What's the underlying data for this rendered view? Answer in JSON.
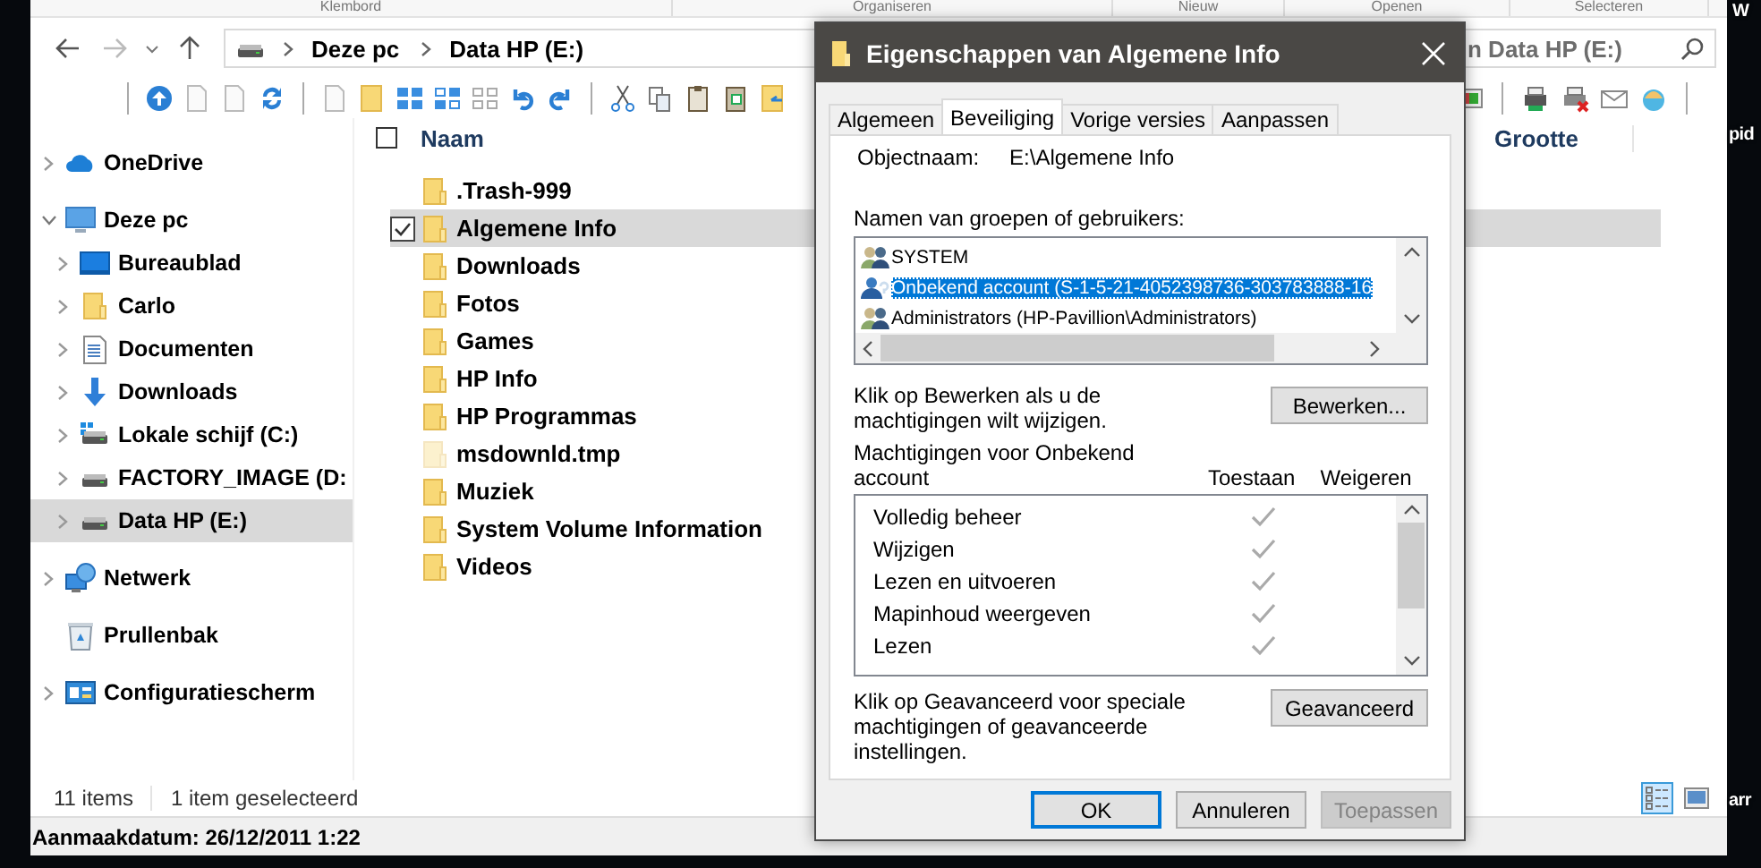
{
  "ribbon_groups": [
    "Klembord",
    "Organiseren",
    "Nieuw",
    "Openen",
    "Selecteren"
  ],
  "address": {
    "segments": [
      "Deze pc",
      "Data HP (E:)"
    ]
  },
  "search": {
    "placeholder": "n Data HP (E:)"
  },
  "columns": [
    "Naam",
    "Grootte"
  ],
  "select_all": {
    "checked": false
  },
  "sidebar": {
    "items": [
      {
        "label": "OneDrive",
        "kind": "cloud",
        "expandable": true,
        "expanded": false,
        "selected": false
      },
      {
        "label": "Deze pc",
        "kind": "computer",
        "expandable": true,
        "expanded": true,
        "selected": false,
        "children": [
          {
            "label": "Bureaublad",
            "kind": "desktop",
            "expandable": true,
            "expanded": false,
            "selected": false
          },
          {
            "label": "Carlo",
            "kind": "folder",
            "expandable": true,
            "expanded": false,
            "selected": false
          },
          {
            "label": "Documenten",
            "kind": "document",
            "expandable": true,
            "expanded": false,
            "selected": false
          },
          {
            "label": "Downloads",
            "kind": "download",
            "expandable": true,
            "expanded": false,
            "selected": false
          },
          {
            "label": "Lokale schijf (C:)",
            "kind": "system-drive",
            "expandable": true,
            "expanded": false,
            "selected": false
          },
          {
            "label": "FACTORY_IMAGE (D:",
            "kind": "drive",
            "expandable": true,
            "expanded": false,
            "selected": false
          },
          {
            "label": "Data HP (E:)",
            "kind": "drive",
            "expandable": true,
            "expanded": false,
            "selected": true
          }
        ]
      },
      {
        "label": "Netwerk",
        "kind": "network",
        "expandable": true,
        "expanded": false,
        "selected": false
      },
      {
        "label": "Prullenbak",
        "kind": "recycle-bin",
        "expandable": false,
        "selected": false
      },
      {
        "label": "Configuratiescherm",
        "kind": "control-panel",
        "expandable": true,
        "expanded": false,
        "selected": false
      }
    ]
  },
  "files": [
    {
      "name": ".Trash-999",
      "kind": "folder",
      "selected": false
    },
    {
      "name": "Algemene Info",
      "kind": "folder",
      "selected": true
    },
    {
      "name": "Downloads",
      "kind": "folder",
      "selected": false
    },
    {
      "name": "Fotos",
      "kind": "folder",
      "selected": false
    },
    {
      "name": "Games",
      "kind": "folder",
      "selected": false
    },
    {
      "name": "HP Info",
      "kind": "folder",
      "selected": false
    },
    {
      "name": "HP Programmas",
      "kind": "folder",
      "selected": false
    },
    {
      "name": "msdownld.tmp",
      "kind": "hidden-folder",
      "selected": false
    },
    {
      "name": "Muziek",
      "kind": "folder",
      "selected": false
    },
    {
      "name": "System Volume Information",
      "kind": "folder",
      "selected": false
    },
    {
      "name": "Videos",
      "kind": "folder",
      "selected": false
    }
  ],
  "status_bar": {
    "count": "11 items",
    "selection": "1 item geselecteerd",
    "views": [
      {
        "selected": true
      },
      {
        "selected": false
      }
    ]
  },
  "details_bar": {
    "text": "Aanmaakdatum: 26/12/2011 1:22"
  },
  "desktop_labels": [
    "W",
    "pid",
    "arr"
  ],
  "dialog": {
    "title": "Eigenschappen van Algemene Info",
    "tabs": [
      {
        "label": "Algemeen",
        "selected": false
      },
      {
        "label": "Beveiliging",
        "selected": true
      },
      {
        "label": "Vorige versies",
        "selected": false
      },
      {
        "label": "Aanpassen",
        "selected": false
      }
    ],
    "object_label": "Objectnaam:",
    "object_value": "E:\\Algemene Info",
    "principals_label": "Namen van groepen of gebruikers:",
    "principals": [
      {
        "name": "SYSTEM",
        "kind": "group",
        "selected": false
      },
      {
        "name": "Onbekend account (S-1-5-21-4052398736-303783888-16",
        "kind": "unknown",
        "selected": true
      },
      {
        "name": "Administrators (HP-Pavillion\\Administrators)",
        "kind": "group",
        "selected": false
      }
    ],
    "edit_hint": "Klik op Bewerken als u de machtigingen wilt wijzigen.",
    "edit_button": "Bewerken...",
    "permissions_label": "Machtigingen voor Onbekend account",
    "allow_header": "Toestaan",
    "deny_header": "Weigeren",
    "permissions": [
      {
        "name": "Volledig beheer",
        "allow": true,
        "deny": false
      },
      {
        "name": "Wijzigen",
        "allow": true,
        "deny": false
      },
      {
        "name": "Lezen en uitvoeren",
        "allow": true,
        "deny": false
      },
      {
        "name": "Mapinhoud weergeven",
        "allow": true,
        "deny": false
      },
      {
        "name": "Lezen",
        "allow": true,
        "deny": false
      }
    ],
    "advanced_hint": "Klik op Geavanceerd voor speciale machtigingen of geavanceerde instellingen.",
    "advanced_button": "Geavanceerd",
    "buttons": [
      {
        "label": "OK",
        "kind": "default",
        "disabled": false
      },
      {
        "label": "Annuleren",
        "kind": "normal",
        "disabled": false
      },
      {
        "label": "Toepassen",
        "kind": "normal",
        "disabled": true
      }
    ]
  }
}
